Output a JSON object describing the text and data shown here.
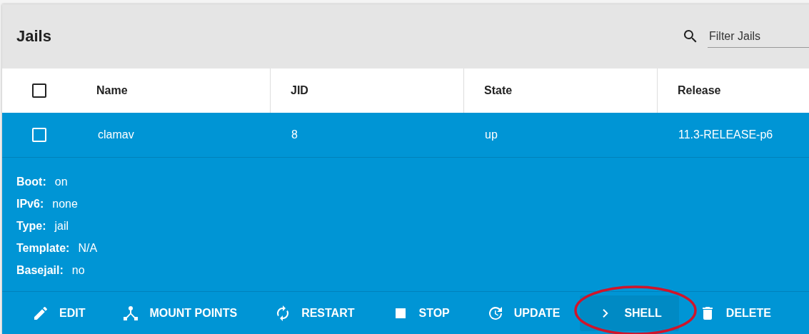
{
  "title": "Jails",
  "search": {
    "placeholder": "Filter Jails"
  },
  "table": {
    "select_all": {
      "checked": false
    },
    "columns": [
      "Name",
      "JID",
      "State",
      "Release"
    ],
    "rows": [
      {
        "checked": false,
        "selected": true,
        "cells": [
          "clamav",
          "8",
          "up",
          "11.3-RELEASE-p6"
        ]
      }
    ]
  },
  "details": [
    {
      "label": "Boot:",
      "value": "on"
    },
    {
      "label": "IPv6:",
      "value": "none"
    },
    {
      "label": "Type:",
      "value": "jail"
    },
    {
      "label": "Template:",
      "value": "N/A"
    },
    {
      "label": "Basejail:",
      "value": "no"
    }
  ],
  "actions": [
    {
      "kind": "edit",
      "label": "EDIT",
      "hovered": false
    },
    {
      "kind": "mount",
      "label": "MOUNT POINTS",
      "hovered": false
    },
    {
      "kind": "restart",
      "label": "RESTART",
      "hovered": false
    },
    {
      "kind": "stop",
      "label": "STOP",
      "hovered": false
    },
    {
      "kind": "update",
      "label": "UPDATE",
      "hovered": false
    },
    {
      "kind": "shell",
      "label": "SHELL",
      "hovered": true
    },
    {
      "kind": "delete",
      "label": "DELETE",
      "hovered": false
    }
  ]
}
